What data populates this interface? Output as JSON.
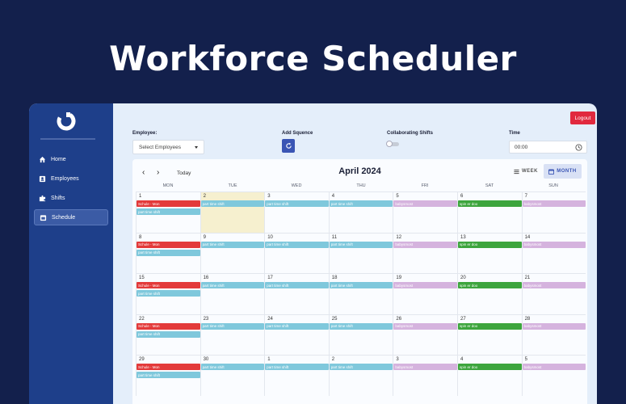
{
  "hero": {
    "title": "Workforce Scheduler"
  },
  "sidebar": {
    "items": [
      {
        "label": "Home",
        "icon": "home-icon"
      },
      {
        "label": "Employees",
        "icon": "employees-icon"
      },
      {
        "label": "Shifts",
        "icon": "shifts-icon"
      },
      {
        "label": "Schedule",
        "icon": "schedule-icon",
        "active": true
      }
    ]
  },
  "header": {
    "logout_label": "Logout",
    "employee_label": "Employee:",
    "employee_placeholder": "Select Employees",
    "sequence_label": "Add Squence",
    "collab_label": "Collaborating Shifts",
    "time_label": "Time",
    "time_value": "00:00"
  },
  "calendar": {
    "title": "April 2024",
    "today_label": "Today",
    "week_label": "WEEK",
    "month_label": "MONTH",
    "days": [
      "MON",
      "TUE",
      "WED",
      "THU",
      "FRI",
      "SAT",
      "SUN"
    ],
    "weeks": [
      [
        "1",
        "2",
        "3",
        "4",
        "5",
        "6",
        "7"
      ],
      [
        "8",
        "9",
        "10",
        "11",
        "12",
        "13",
        "14"
      ],
      [
        "15",
        "16",
        "17",
        "18",
        "19",
        "20",
        "21"
      ],
      [
        "22",
        "23",
        "24",
        "25",
        "26",
        "27",
        "28"
      ],
      [
        "29",
        "30",
        "1",
        "2",
        "3",
        "4",
        "5"
      ]
    ],
    "today_week": 0,
    "today_day": 1,
    "event_labels": {
      "schule": "Schule - Mon",
      "part_time": "part time shift",
      "baby": "babysmost",
      "spin": "spin er doo"
    },
    "event_colors": {
      "schule": "#e33a3a",
      "part_time": "#7fc8dc",
      "baby": "#d5b3de",
      "spin": "#3da53d"
    },
    "pattern": [
      [
        [
          "schule",
          "part_time"
        ]
      ],
      [
        [
          "part_time"
        ]
      ],
      [
        [
          "part_time"
        ]
      ],
      [
        [
          "part_time"
        ]
      ],
      [
        [
          "baby"
        ]
      ],
      [
        [
          "spin"
        ]
      ],
      [
        [
          "baby"
        ]
      ]
    ]
  }
}
